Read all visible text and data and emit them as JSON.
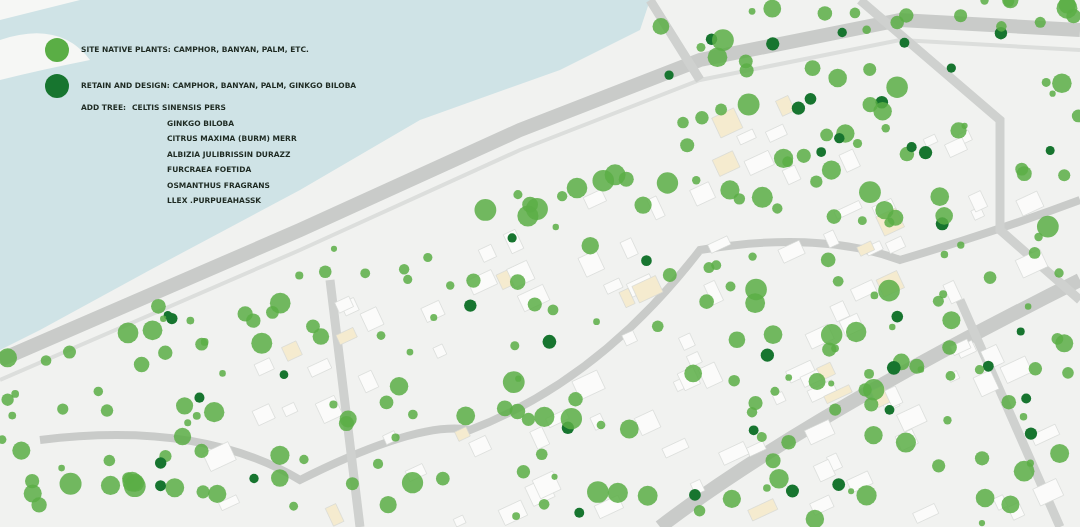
{
  "legend": [
    {
      "label": "SITE NATIVE PLANTS: CAMPHOR, BANYAN, PALM, ETC.",
      "color": "#5aae45"
    },
    {
      "label": "RETAIN AND DESIGN: CAMPHOR, BANYAN, PALM, GINKGO BILOBA",
      "color": "#17752f"
    }
  ],
  "add_tree": {
    "label": "ADD TREE:",
    "species": [
      "CELTIS SINENSIS PERS",
      "GINKGO BILOBA",
      "CITRUS MAXIMA (BURM) MERR",
      "ALBIZIA JULIBRISSIN DURAZZ",
      "FURCRAEA FOETIDA",
      "OSMANTHUS FRAGRANS",
      "LLEX .PURPUEAHASSK"
    ]
  }
}
